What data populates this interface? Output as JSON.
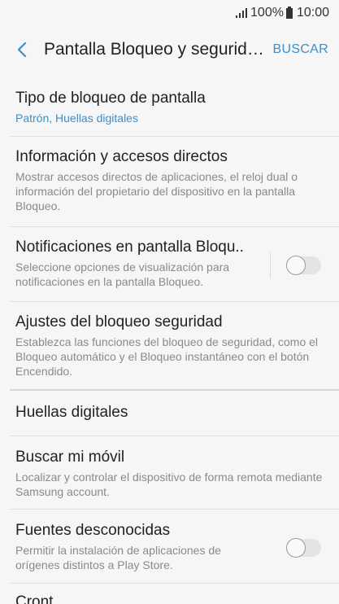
{
  "status_bar": {
    "battery_percent": "100%",
    "time": "10:00"
  },
  "app_bar": {
    "title": "Pantalla Bloqueo y segurid…",
    "search_label": "BUSCAR"
  },
  "items": [
    {
      "title": "Tipo de bloqueo de pantalla",
      "subtitle": "Patrón, Huellas digitales"
    },
    {
      "title": "Información y accesos directos",
      "subtitle": "Mostrar accesos directos de aplicaciones, el reloj dual o información del propietario del dispositivo en la pantalla Bloqueo."
    },
    {
      "title": "Notificaciones en pantalla Bloqu..",
      "subtitle": "Seleccione opciones de visualización para notificaciones en la pantalla Bloqueo.",
      "toggle_on": false
    },
    {
      "title": "Ajustes del bloqueo seguridad",
      "subtitle": "Establezca las funciones del bloqueo de seguridad, como el Bloqueo automático y el Bloqueo instantáneo con el botón Encendido."
    },
    {
      "title": "Huellas digitales"
    },
    {
      "title": "Buscar mi móvil",
      "subtitle": "Localizar y controlar el dispositivo de forma remota mediante Samsung account."
    },
    {
      "title": "Fuentes desconocidas",
      "subtitle": "Permitir la instalación de aplicaciones de orígenes distintos a Play Store.",
      "toggle_on": false
    },
    {
      "title": "Cront..."
    }
  ],
  "colors": {
    "accent": "#3f8ec7",
    "background": "#f6f6f6"
  }
}
